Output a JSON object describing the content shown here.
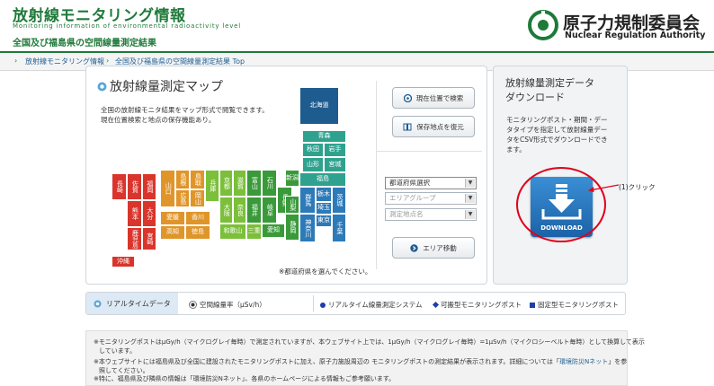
{
  "header": {
    "title": "放射線モニタリング情報",
    "subtitle": "Monitoring information of environmental radioactivity level",
    "tagline": "全国及び福島県の空間線量測定結果",
    "org_ja": "原子力規制委員会",
    "org_en": "Nuclear Regulation Authority",
    "brand_color": "#1f7a3a"
  },
  "breadcrumb": {
    "items": [
      "放射線モニタリング情報",
      "全国及び福島県の空間線量測定結果 Top"
    ]
  },
  "map": {
    "title": "放射線量測定マップ",
    "desc1": "全国の放射線モニタ結果をマップ形式で閲覧できます。",
    "desc2": "現在位置検索と地点の保存機能あり。",
    "note": "※都道府県を選んでください。",
    "prefectures": {
      "hokkaido": "北海道",
      "aomori": "青森",
      "akita": "秋田",
      "iwate": "岩手",
      "yamagata": "山形",
      "miyagi": "宮城",
      "fukushima": "福島",
      "niigata": "新潟",
      "ibaraki": "茨城",
      "tochigi": "栃木",
      "gunma": "群馬",
      "saitama": "埼玉",
      "chiba": "千葉",
      "tokyo": "東京",
      "kanagawa": "神奈川",
      "yamanashi": "山梨",
      "nagano": "長野",
      "shizuoka": "静岡",
      "toyama": "富山",
      "ishikawa": "石川",
      "fukui": "福井",
      "gifu": "岐阜",
      "aichi": "愛知",
      "mie": "三重",
      "shiga": "滋賀",
      "kyoto": "京都",
      "osaka": "大阪",
      "hyogo": "兵庫",
      "nara": "奈良",
      "wakayama": "和歌山",
      "tottori": "鳥取",
      "shimane": "島根",
      "okayama": "岡山",
      "hiroshima": "広島",
      "yamaguchi": "山口",
      "kagawa": "香川",
      "ehime": "愛媛",
      "tokushima": "徳島",
      "kochi": "高知",
      "fukuoka": "福岡",
      "saga": "佐賀",
      "nagasaki": "長崎",
      "kumamoto": "熊本",
      "oita": "大分",
      "miyazaki": "宮崎",
      "kagoshima": "鹿児島",
      "okinawa": "沖縄"
    }
  },
  "controls": {
    "current_location": "現在位置で検索",
    "restore_saved": "保存地点を復元",
    "pref_select": "都道府県選択",
    "area_group": "エリアグループ",
    "point_name": "測定地点名",
    "area_move": "エリア移動"
  },
  "download": {
    "title1": "放射線量測定データ",
    "title2": "ダウンロード",
    "desc1": "モニタリングポスト・期間・デー",
    "desc2": "タタイプを指定して放射線量デー",
    "desc3": "タをCSV形式でダウンロードでき",
    "desc4": "ます。",
    "button_label": "DOWNLOAD",
    "annotation": "(1)クリック"
  },
  "tabs": {
    "realtime": "リアルタイムデータ",
    "dose_rate": "空間線量率（μSv/h）",
    "legend_realtime_system": "リアルタイム線量測定システム",
    "legend_portable": "可搬型モニタリングポスト",
    "legend_fixed": "固定型モニタリングポスト"
  },
  "notes": {
    "line1": "※モニタリングポストはμGy/h（マイクログレイ毎時）で測定されていますが、本ウェブサイト上では、1μGy/h（マイクログレイ毎時）=1μSv/h（マイクロシーベルト毎時）として換算して表示",
    "line1b": "しています。",
    "line2": "※本ウェブサイトには福島県及び全国に建設されたモニタリングポストに加え、原子力施設周辺の モニタリングポストの測定結果が表示されます。詳細については「",
    "line2_link": "環境防災Nネット",
    "line2_end": "」を参",
    "line2b": "照してください。",
    "line3": "※特に、福島県及び隣県の情報は「環境防災Nネット」、各県のホームページによる情報もご参考願います。"
  }
}
